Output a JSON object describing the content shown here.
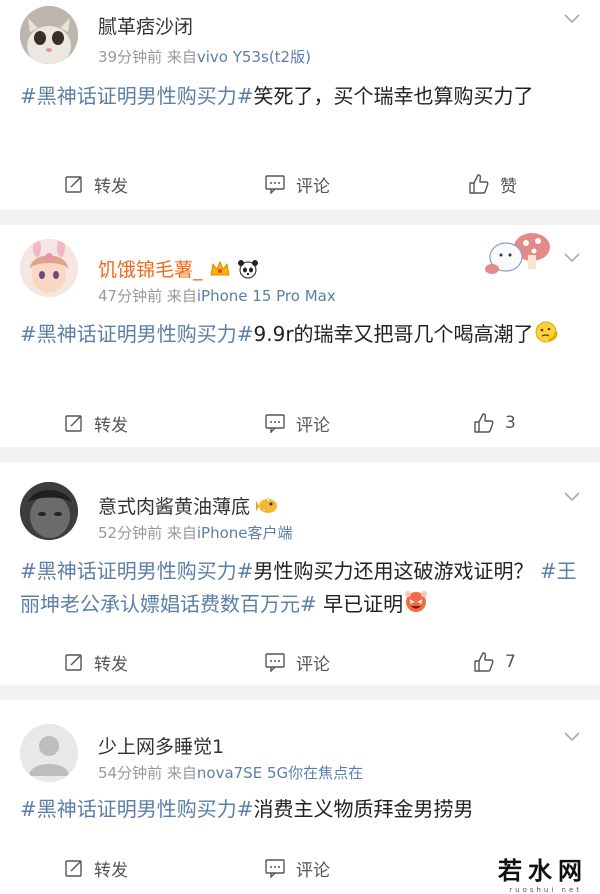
{
  "posts": [
    {
      "username": "腻革痞沙闭",
      "time": "39分钟前",
      "source_prefix": "来自",
      "source": "vivo Y53s(t2版)",
      "hashtag": "#黑神话证明男性购买力#",
      "text": "笑死了，买个瑞幸也算购买力了",
      "repost_label": "转发",
      "comment_label": "评论",
      "like_label": "赞"
    },
    {
      "username": "饥饿锦毛薯_",
      "time": "47分钟前",
      "source_prefix": "来自",
      "source": "iPhone 15 Pro Max",
      "hashtag": "#黑神话证明男性购买力#",
      "text": "9.9r的瑞幸又把哥几个喝高潮了",
      "repost_label": "转发",
      "comment_label": "评论",
      "like_label": "3"
    },
    {
      "username": "意式肉酱黄油薄底",
      "time": "52分钟前",
      "source_prefix": "来自",
      "source": "iPhone客户端",
      "hashtag": "#黑神话证明男性购买力#",
      "text": "男性购买力还用这破游戏证明？",
      "hashtag2": "#王丽坤老公承认嫖娼话费数百万元#",
      "text2": "早已证明",
      "repost_label": "转发",
      "comment_label": "评论",
      "like_label": "7"
    },
    {
      "username": "少上网多睡觉1",
      "time": "54分钟前",
      "source_prefix": "来自",
      "source": "nova7SE 5G你在焦点在",
      "hashtag": "#黑神话证明男性购买力#",
      "text": "消费主义物质拜金男捞男",
      "repost_label": "转发",
      "comment_label": "评论"
    }
  ],
  "watermark": {
    "text": "若水网",
    "sub": "ruoshui net"
  },
  "colors": {
    "link": "#5b7fa8",
    "vip_name": "#f06a1a",
    "meta": "#999999",
    "separator": "#f2f2f2"
  }
}
